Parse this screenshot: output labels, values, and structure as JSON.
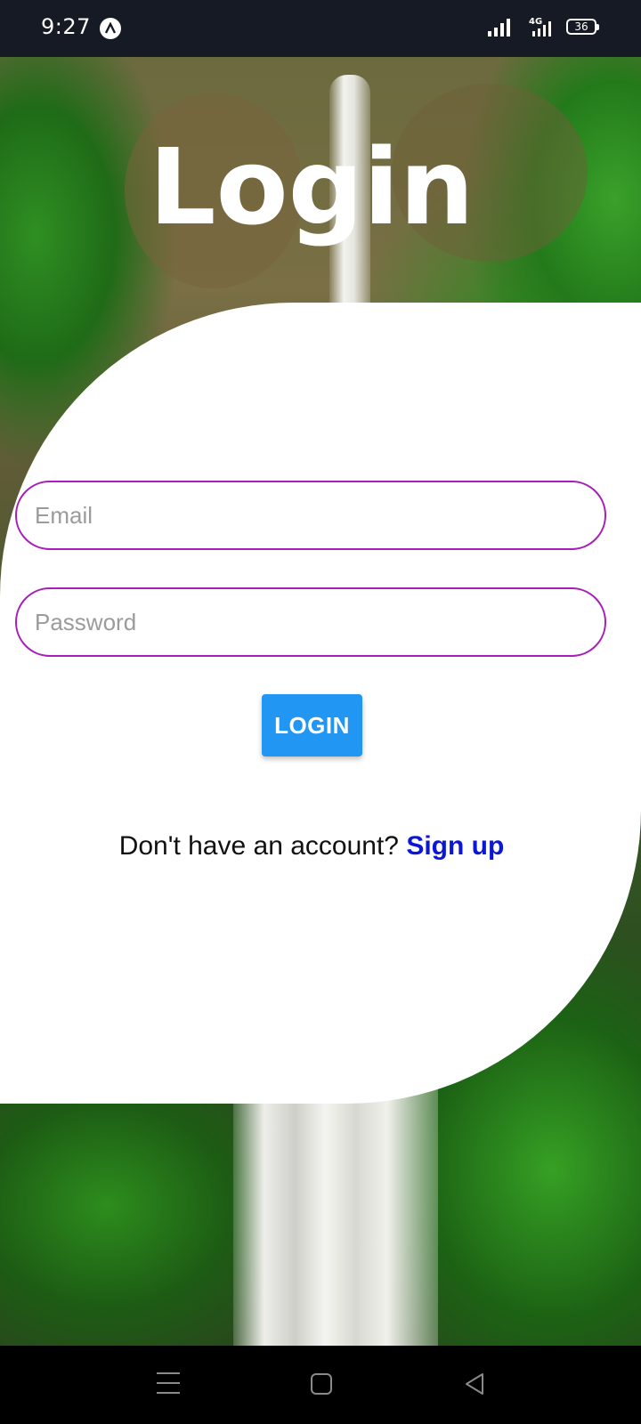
{
  "status_bar": {
    "time": "9:27",
    "network": "4G",
    "battery": "36"
  },
  "screen": {
    "title": "Login"
  },
  "form": {
    "email_placeholder": "Email",
    "password_placeholder": "Password",
    "login_label": "LOGIN",
    "no_account_text": "Don't have an account?",
    "signup_label": "Sign up"
  },
  "colors": {
    "field_border": "#a71fb8",
    "button": "#2196f3",
    "link": "#0a17d6"
  },
  "nav": {
    "icons": [
      "menu-icon",
      "home-icon",
      "back-icon"
    ]
  }
}
